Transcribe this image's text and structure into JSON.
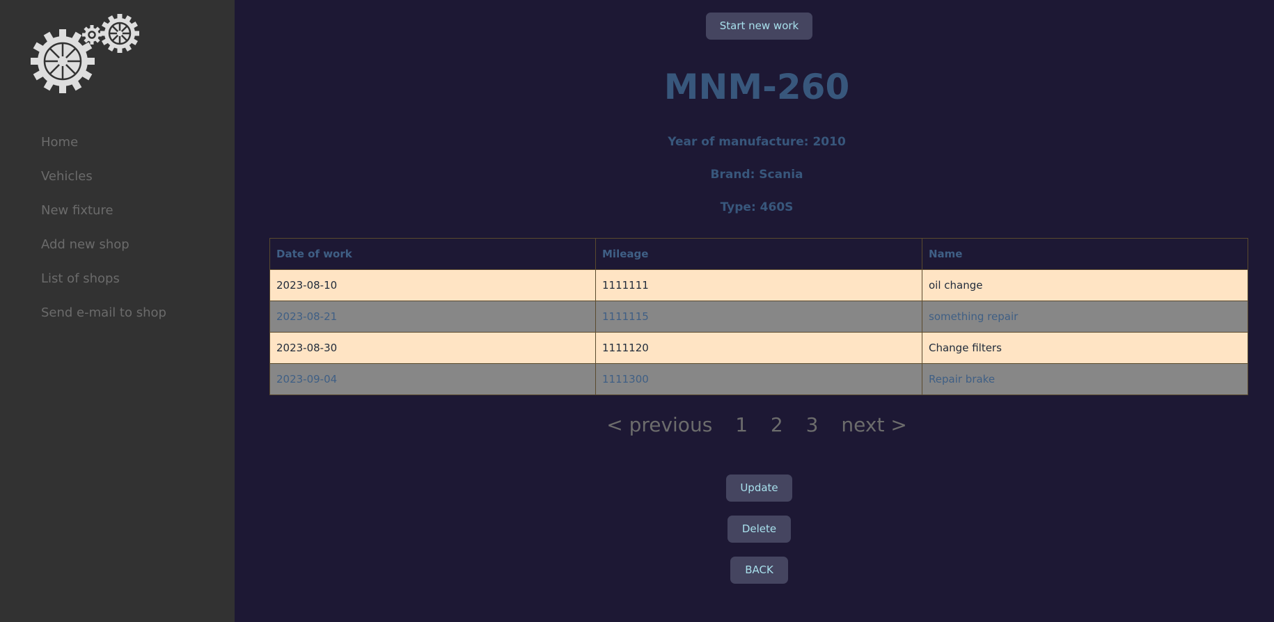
{
  "sidebar": {
    "logo": "gears-logo",
    "items": [
      {
        "label": "Home"
      },
      {
        "label": "Vehicles"
      },
      {
        "label": "New fixture"
      },
      {
        "label": "Add new shop"
      },
      {
        "label": "List of shops"
      },
      {
        "label": "Send e-mail to shop"
      }
    ]
  },
  "main": {
    "start_new_work": "Start new work",
    "vehicle": {
      "plate": "MNM-260",
      "year": "Year of manufacture: 2010",
      "brand": "Brand: Scania",
      "type": "Type: 460S"
    },
    "table": {
      "headers": [
        "Date of work",
        "Mileage",
        "Name"
      ],
      "rows": [
        [
          "2023-08-10",
          "1111111",
          "oil change"
        ],
        [
          "2023-08-21",
          "1111115",
          "something repair"
        ],
        [
          "2023-08-30",
          "1111120",
          "Change filters"
        ],
        [
          "2023-09-04",
          "1111300",
          "Repair brake"
        ]
      ]
    },
    "pagination": {
      "previous": "< previous",
      "pages": [
        "1",
        "2",
        "3"
      ],
      "next": "next >"
    },
    "buttons": {
      "update": "Update",
      "delete": "Delete",
      "back": "BACK"
    }
  },
  "colors": {
    "background": "#1d1834",
    "sidebar": "#323232",
    "accent_text": "#38577c",
    "button_bg": "#454560",
    "button_text": "#a8e0ec",
    "row_light": "#ffe4c4",
    "row_gray": "#878787"
  }
}
